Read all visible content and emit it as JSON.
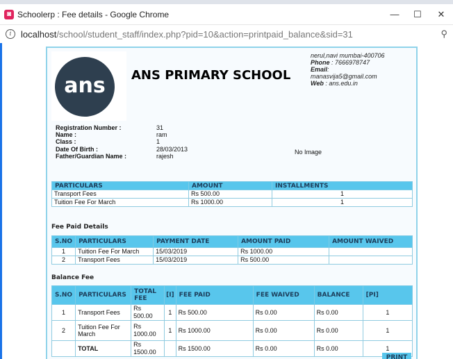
{
  "window": {
    "title": "Schoolerp : Fee details - Google Chrome",
    "minimize": "—",
    "maximize": "☐",
    "close": "✕"
  },
  "address": {
    "host": "localhost",
    "path": "/school/student_staff/index.php?pid=10&action=printpaid_balance&sid=31"
  },
  "school": {
    "logo_text": "ans",
    "name": "ANS PRIMARY SCHOOL",
    "address": "nerul,navi mumbai-400706",
    "phone_label": "Phone",
    "phone": " : 7666978747",
    "email_label": "Email",
    "email": "manasvija5@gmail.com",
    "web_label": "Web",
    "web": " : ans.edu.in"
  },
  "student": {
    "labels": [
      "Registration Number :",
      "Name :",
      "Class :",
      "Date Of Birth :",
      "Father/Guardian Name :"
    ],
    "values": [
      "31",
      "ram",
      "1",
      "28/03/2013",
      "rajesh"
    ],
    "image_text": "No Image"
  },
  "particulars_table": {
    "headers": [
      "PARTICULARS",
      "AMOUNT",
      "INSTALLMENTS"
    ],
    "rows": [
      [
        "Transport Fees",
        "Rs 500.00",
        "1"
      ],
      [
        "Tuition Fee For March",
        "Rs 1000.00",
        "1"
      ]
    ]
  },
  "fee_paid": {
    "title": "Fee Paid Details",
    "headers": [
      "S.NO",
      "PARTICULARS",
      "PAYMENT DATE",
      "AMOUNT PAID",
      "AMOUNT WAIVED"
    ],
    "rows": [
      [
        "1",
        "Tuition Fee For March",
        "15/03/2019",
        "Rs 1000.00",
        ""
      ],
      [
        "2",
        "Transport Fees",
        "15/03/2019",
        "Rs 500.00",
        ""
      ]
    ]
  },
  "balance": {
    "title": "Balance Fee",
    "headers": [
      "S.NO",
      "PARTICULARS",
      "TOTAL FEE",
      "[I]",
      "FEE PAID",
      "FEE WAIVED",
      "BALANCE",
      "[PI]"
    ],
    "rows": [
      [
        "1",
        "Transport Fees",
        "Rs 500.00",
        "1",
        "Rs 500.00",
        "Rs 0.00",
        "Rs 0.00",
        "1"
      ],
      [
        "2",
        "Tuition Fee For March",
        "Rs 1000.00",
        "1",
        "Rs 1000.00",
        "Rs 0.00",
        "Rs 0.00",
        "1"
      ]
    ],
    "total": [
      "TOTAL",
      "Rs 1500.00",
      "Rs 1500.00",
      "Rs 0.00",
      "Rs 0.00",
      "1"
    ]
  },
  "print_label": "PRINT"
}
